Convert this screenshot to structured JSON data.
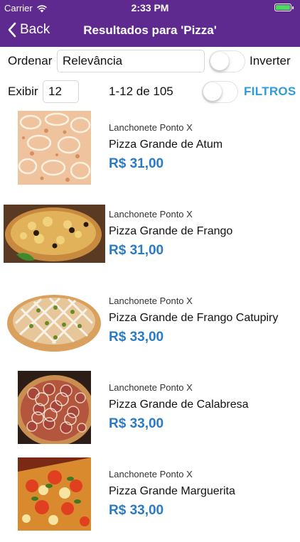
{
  "status": {
    "carrier": "Carrier",
    "time": "2:33 PM"
  },
  "nav": {
    "back_label": "Back",
    "title": "Resultados para 'Pizza'"
  },
  "sort": {
    "label": "Ordenar",
    "value": "Relevância",
    "invert_label": "Inverter",
    "invert_on": false
  },
  "display": {
    "label": "Exibir",
    "count": "12",
    "range": "1-12 de 105",
    "filter_on": false,
    "filters_label": "FILTROS"
  },
  "products": [
    {
      "store": "Lanchonete Ponto X",
      "name": "Pizza Grande de Atum",
      "price": "R$ 31,00"
    },
    {
      "store": "Lanchonete Ponto X",
      "name": "Pizza Grande de Frango",
      "price": "R$ 31,00"
    },
    {
      "store": "Lanchonete Ponto X",
      "name": "Pizza Grande de Frango Catupiry",
      "price": "R$ 33,00"
    },
    {
      "store": "Lanchonete Ponto X",
      "name": "Pizza Grande de Calabresa",
      "price": "R$ 33,00"
    },
    {
      "store": "Lanchonete Ponto X",
      "name": "Pizza Grande Marguerita",
      "price": "R$ 33,00"
    }
  ],
  "colors": {
    "nav_bg": "#5e2a8f",
    "price": "#2a7bc4",
    "filters": "#2f9bd9",
    "battery": "#4cd964"
  }
}
